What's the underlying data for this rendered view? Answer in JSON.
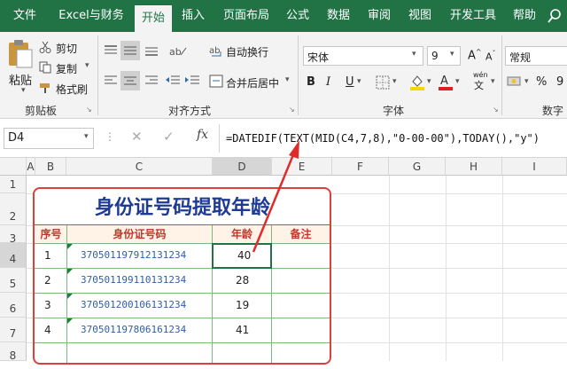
{
  "tabs": [
    "文件",
    "Excel与财务",
    "开始",
    "插入",
    "页面布局",
    "公式",
    "数据",
    "审阅",
    "视图",
    "开发工具",
    "帮助"
  ],
  "ribbon": {
    "paste": "粘贴",
    "cut": "剪切",
    "copy": "复制",
    "format_painter": "格式刷",
    "clipboard_group": "剪贴板",
    "wrap_text": "自动换行",
    "merge_center": "合并后居中",
    "align_group": "对齐方式",
    "font_name": "宋体",
    "font_size": "9",
    "bold": "B",
    "italic": "I",
    "underline": "U",
    "font_group": "字体",
    "number_format": "常规",
    "number_group": "数字",
    "percent": "%",
    "comma": "9",
    "wen": "wén",
    "wen_char": "文"
  },
  "formula_bar": {
    "name_box": "D4",
    "fx": "fx",
    "formula": "=DATEDIF(TEXT(MID(C4,7,8),\"0-00-00\"),TODAY(),\"y\")"
  },
  "columns": [
    "A",
    "B",
    "C",
    "D",
    "E",
    "F",
    "G",
    "H",
    "I"
  ],
  "rows": [
    "1",
    "2",
    "3",
    "4",
    "5",
    "6",
    "7",
    "8"
  ],
  "sheet": {
    "title": "身份证号码提取年龄",
    "headers": [
      "序号",
      "身份证号码",
      "年龄",
      "备注"
    ],
    "data": [
      [
        "1",
        "370501197912131234",
        "40",
        ""
      ],
      [
        "2",
        "370501199110131234",
        "28",
        ""
      ],
      [
        "3",
        "370501200106131234",
        "19",
        ""
      ],
      [
        "4",
        "370501197806161234",
        "41",
        ""
      ]
    ]
  },
  "colors": {
    "excel_green": "#217346",
    "table_border": "#d9413a",
    "title": "#1f3a93",
    "id_text": "#2f5fa7",
    "arrow": "#e02b2b"
  }
}
